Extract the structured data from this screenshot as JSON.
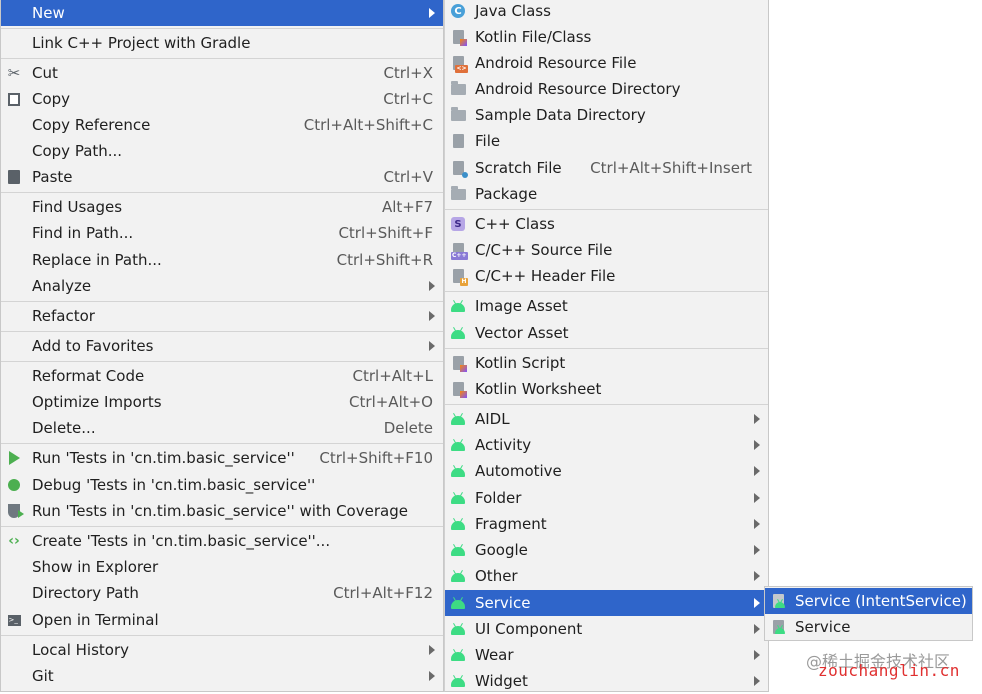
{
  "main_menu": {
    "items": [
      {
        "label": "New"
      },
      {
        "label": "Link C++ Project with Gradle"
      },
      {
        "label": "Cut",
        "shortcut": "Ctrl+X"
      },
      {
        "label": "Copy",
        "shortcut": "Ctrl+C"
      },
      {
        "label": "Copy Reference",
        "shortcut": "Ctrl+Alt+Shift+C"
      },
      {
        "label": "Copy Path..."
      },
      {
        "label": "Paste",
        "shortcut": "Ctrl+V"
      },
      {
        "label": "Find Usages",
        "shortcut": "Alt+F7"
      },
      {
        "label": "Find in Path...",
        "shortcut": "Ctrl+Shift+F"
      },
      {
        "label": "Replace in Path...",
        "shortcut": "Ctrl+Shift+R"
      },
      {
        "label": "Analyze"
      },
      {
        "label": "Refactor"
      },
      {
        "label": "Add to Favorites"
      },
      {
        "label": "Reformat Code",
        "shortcut": "Ctrl+Alt+L"
      },
      {
        "label": "Optimize Imports",
        "shortcut": "Ctrl+Alt+O"
      },
      {
        "label": "Delete...",
        "shortcut": "Delete"
      },
      {
        "label": "Run 'Tests in 'cn.tim.basic_service''",
        "shortcut": "Ctrl+Shift+F10"
      },
      {
        "label": "Debug 'Tests in 'cn.tim.basic_service''"
      },
      {
        "label": "Run 'Tests in 'cn.tim.basic_service'' with Coverage"
      },
      {
        "label": "Create 'Tests in 'cn.tim.basic_service''..."
      },
      {
        "label": "Show in Explorer"
      },
      {
        "label": "Directory Path",
        "shortcut": "Ctrl+Alt+F12"
      },
      {
        "label": "Open in Terminal"
      },
      {
        "label": "Local History"
      },
      {
        "label": "Git"
      }
    ]
  },
  "new_menu": {
    "items": [
      {
        "label": "Java Class"
      },
      {
        "label": "Kotlin File/Class"
      },
      {
        "label": "Android Resource File"
      },
      {
        "label": "Android Resource Directory"
      },
      {
        "label": "Sample Data Directory"
      },
      {
        "label": "File"
      },
      {
        "label": "Scratch File",
        "shortcut": "Ctrl+Alt+Shift+Insert"
      },
      {
        "label": "Package"
      },
      {
        "label": "C++ Class"
      },
      {
        "label": "C/C++ Source File"
      },
      {
        "label": "C/C++ Header File"
      },
      {
        "label": "Image Asset"
      },
      {
        "label": "Vector Asset"
      },
      {
        "label": "Kotlin Script"
      },
      {
        "label": "Kotlin Worksheet"
      },
      {
        "label": "AIDL"
      },
      {
        "label": "Activity"
      },
      {
        "label": "Automotive"
      },
      {
        "label": "Folder"
      },
      {
        "label": "Fragment"
      },
      {
        "label": "Google"
      },
      {
        "label": "Other"
      },
      {
        "label": "Service"
      },
      {
        "label": "UI Component"
      },
      {
        "label": "Wear"
      },
      {
        "label": "Widget"
      }
    ]
  },
  "service_menu": {
    "items": [
      {
        "label": "Service (IntentService)"
      },
      {
        "label": "Service"
      }
    ]
  },
  "badges": {
    "cpp": "C++",
    "header": "H",
    "resource": "<>",
    "class_c": "C",
    "class_s": "S"
  },
  "watermark": {
    "line1": "@稀土掘金技术社区",
    "line2": "zouchanglin.cn"
  },
  "colors": {
    "selection": "#2f65ca",
    "android_green": "#3ddc84",
    "menu_bg": "#f2f2f2"
  }
}
